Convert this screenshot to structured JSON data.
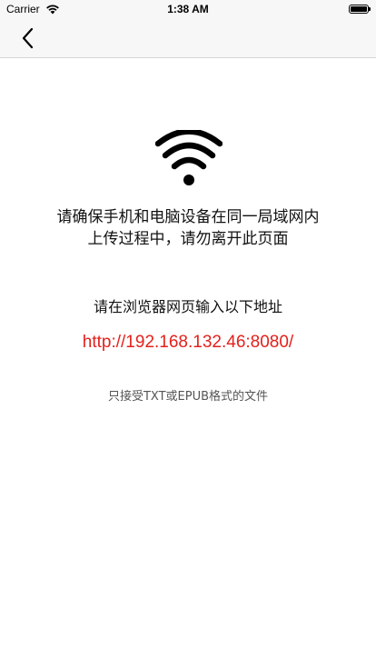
{
  "status_bar": {
    "carrier": "Carrier",
    "time": "1:38 AM",
    "wifi_icon": "wifi-icon",
    "battery_icon": "battery-icon",
    "battery_level": 1.0
  },
  "nav_bar": {
    "back_icon": "chevron-left-icon"
  },
  "main": {
    "wifi_icon": "wifi-icon",
    "message_line1": "请确保手机和电脑设备在同一局域网内",
    "message_line2": "上传过程中，请勿离开此页面",
    "instruction": "请在浏览器网页输入以下地址",
    "url": "http://192.168.132.46:8080/",
    "note": "只接受TXT或EPUB格式的文件"
  },
  "colors": {
    "url": "#e3211c",
    "bar_background": "#f7f7f7",
    "note_text": "#555555"
  }
}
